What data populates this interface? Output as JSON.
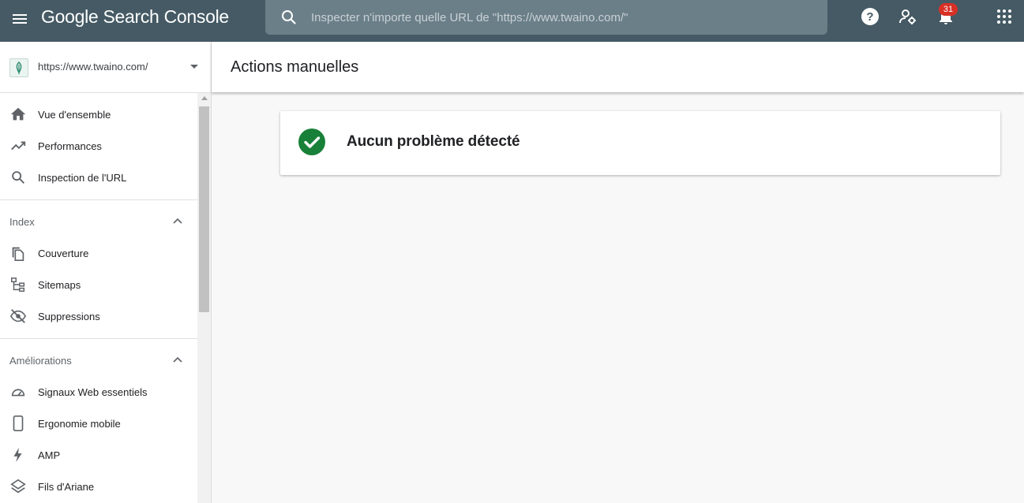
{
  "app": {
    "title": "Google Search Console",
    "brand_color": "#455a64"
  },
  "search": {
    "placeholder": "Inspecter n'importe quelle URL de \"https://www.twaino.com/\""
  },
  "topbar": {
    "icons": [
      "menu-icon",
      "search-icon",
      "help-icon",
      "admin-icon",
      "bell-icon",
      "apps-icon"
    ],
    "notification_count": "31",
    "badge_color": "#d93025"
  },
  "property": {
    "url": "https://www.twaino.com/"
  },
  "sidebar": {
    "main_items": [
      {
        "label": "Vue d'ensemble",
        "icon": "home-icon"
      },
      {
        "label": "Performances",
        "icon": "trending-up-icon"
      },
      {
        "label": "Inspection de l'URL",
        "icon": "search-icon"
      }
    ],
    "index": {
      "header": "Index",
      "items": [
        {
          "label": "Couverture",
          "icon": "copy-icon"
        },
        {
          "label": "Sitemaps",
          "icon": "sitemap-icon"
        },
        {
          "label": "Suppressions",
          "icon": "eye-off-icon"
        }
      ]
    },
    "ameliorations": {
      "header": "Améliorations",
      "items": [
        {
          "label": "Signaux Web essentiels",
          "icon": "speed-icon"
        },
        {
          "label": "Ergonomie mobile",
          "icon": "smartphone-icon"
        },
        {
          "label": "AMP",
          "icon": "bolt-icon"
        },
        {
          "label": "Fils d'Ariane",
          "icon": "layers-icon"
        }
      ]
    }
  },
  "main": {
    "page_title": "Actions manuelles",
    "status_message": "Aucun problème détecté",
    "status_color": "#188038"
  }
}
